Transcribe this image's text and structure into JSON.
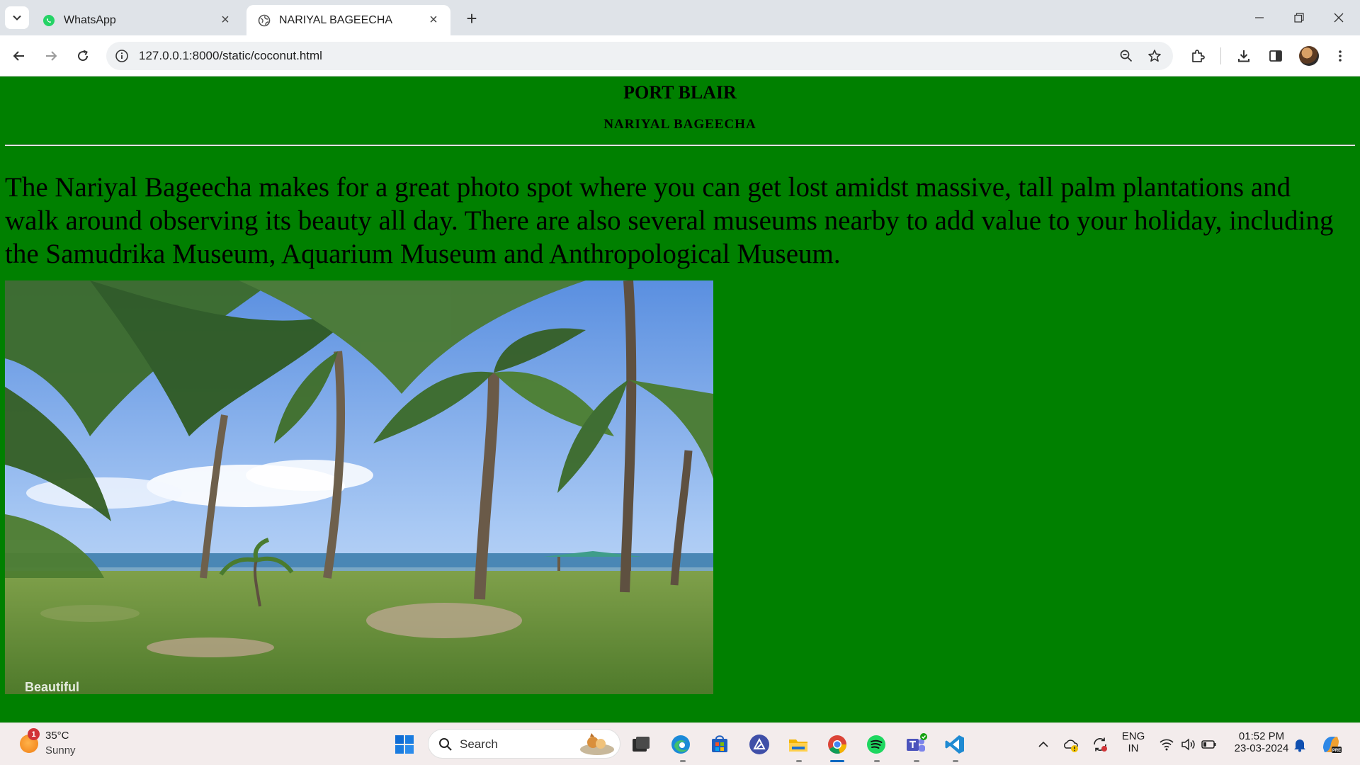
{
  "browser": {
    "tabs": [
      {
        "title": "WhatsApp",
        "icon": "whatsapp-icon",
        "active": false
      },
      {
        "title": "NARIYAL BAGEECHA",
        "icon": "globe-icon",
        "active": true
      }
    ],
    "url": "127.0.0.1:8000/static/coconut.html"
  },
  "page": {
    "heading": "PORT BLAIR",
    "subheading": "NARIYAL BAGEECHA",
    "paragraph": "The Nariyal Bageecha makes for a great photo spot where you can get lost amidst massive, tall palm plantations and walk around observing its beauty all day. There are also several museums nearby to add value to your holiday, including the Samudrika Museum, Aquarium Museum and Anthropological Museum.",
    "image_caption_visible": "Beautiful",
    "background_color": "#008000"
  },
  "taskbar": {
    "weather": {
      "temp": "35°C",
      "condition": "Sunny",
      "badge": "1"
    },
    "search_placeholder": "Search",
    "language": {
      "line1": "ENG",
      "line2": "IN"
    },
    "time": "01:52 PM",
    "date": "23-03-2024"
  }
}
